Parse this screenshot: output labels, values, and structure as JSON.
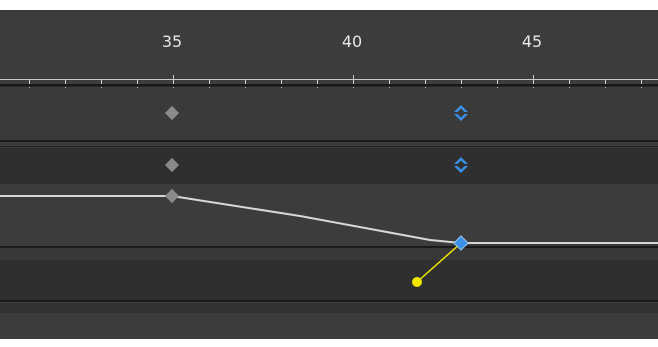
{
  "timeline": {
    "ruler": {
      "labels": [
        "35",
        "40",
        "45"
      ]
    },
    "colors": {
      "background": "#3c3c3c",
      "track_dark": "#2f2f2f",
      "track_mid": "#3a3a3a",
      "curve": "#d8d8d8",
      "keyframe_gray": "#8a8a8a",
      "keyframe_blue": "#3c8fe6",
      "tangent_handle": "#f2e600"
    },
    "icons": {
      "gray_keyframe": "diamond-keyframe-icon",
      "blue_keyframe": "bezier-keyframe-icon",
      "tangent_handle": "tangent-handle-icon"
    }
  }
}
